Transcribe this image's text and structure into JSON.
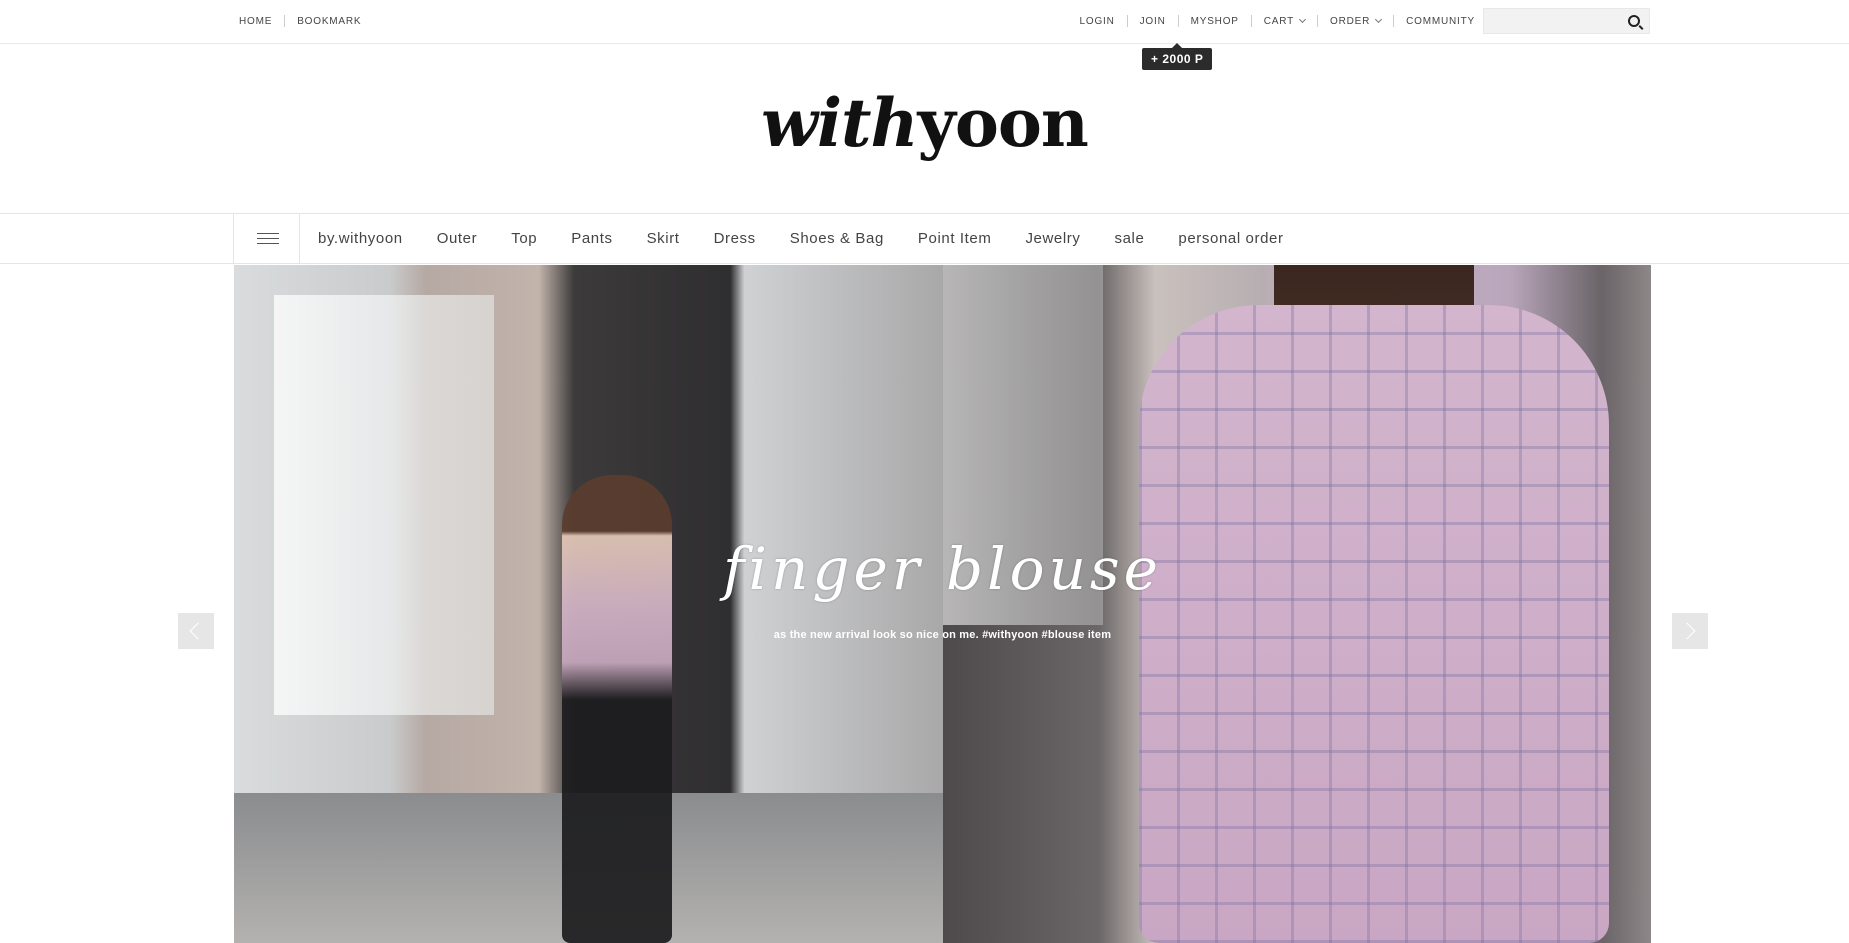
{
  "topbar": {
    "left_links": [
      "HOME",
      "BOOKMARK"
    ],
    "right_links": {
      "login": "LOGIN",
      "join": "JOIN",
      "myshop": "MYSHOP",
      "cart": "CART",
      "order": "ORDER",
      "community": "COMMUNITY"
    },
    "search_placeholder": "",
    "join_tooltip": "+ 2000 P"
  },
  "logo": {
    "part1": "with",
    "part2": "yoon"
  },
  "nav": {
    "categories": [
      "by.withyoon",
      "Outer",
      "Top",
      "Pants",
      "Skirt",
      "Dress",
      "Shoes & Bag",
      "Point Item",
      "Jewelry",
      "sale",
      "personal order"
    ]
  },
  "hero": {
    "title": "finger blouse",
    "subtitle": "as the new arrival look so nice on me. #withyoon #blouse item"
  },
  "icons": {
    "menu": "hamburger-icon",
    "search": "search-icon",
    "prev": "chevron-left-icon",
    "next": "chevron-right-icon",
    "dropdown": "chevron-down-icon"
  }
}
